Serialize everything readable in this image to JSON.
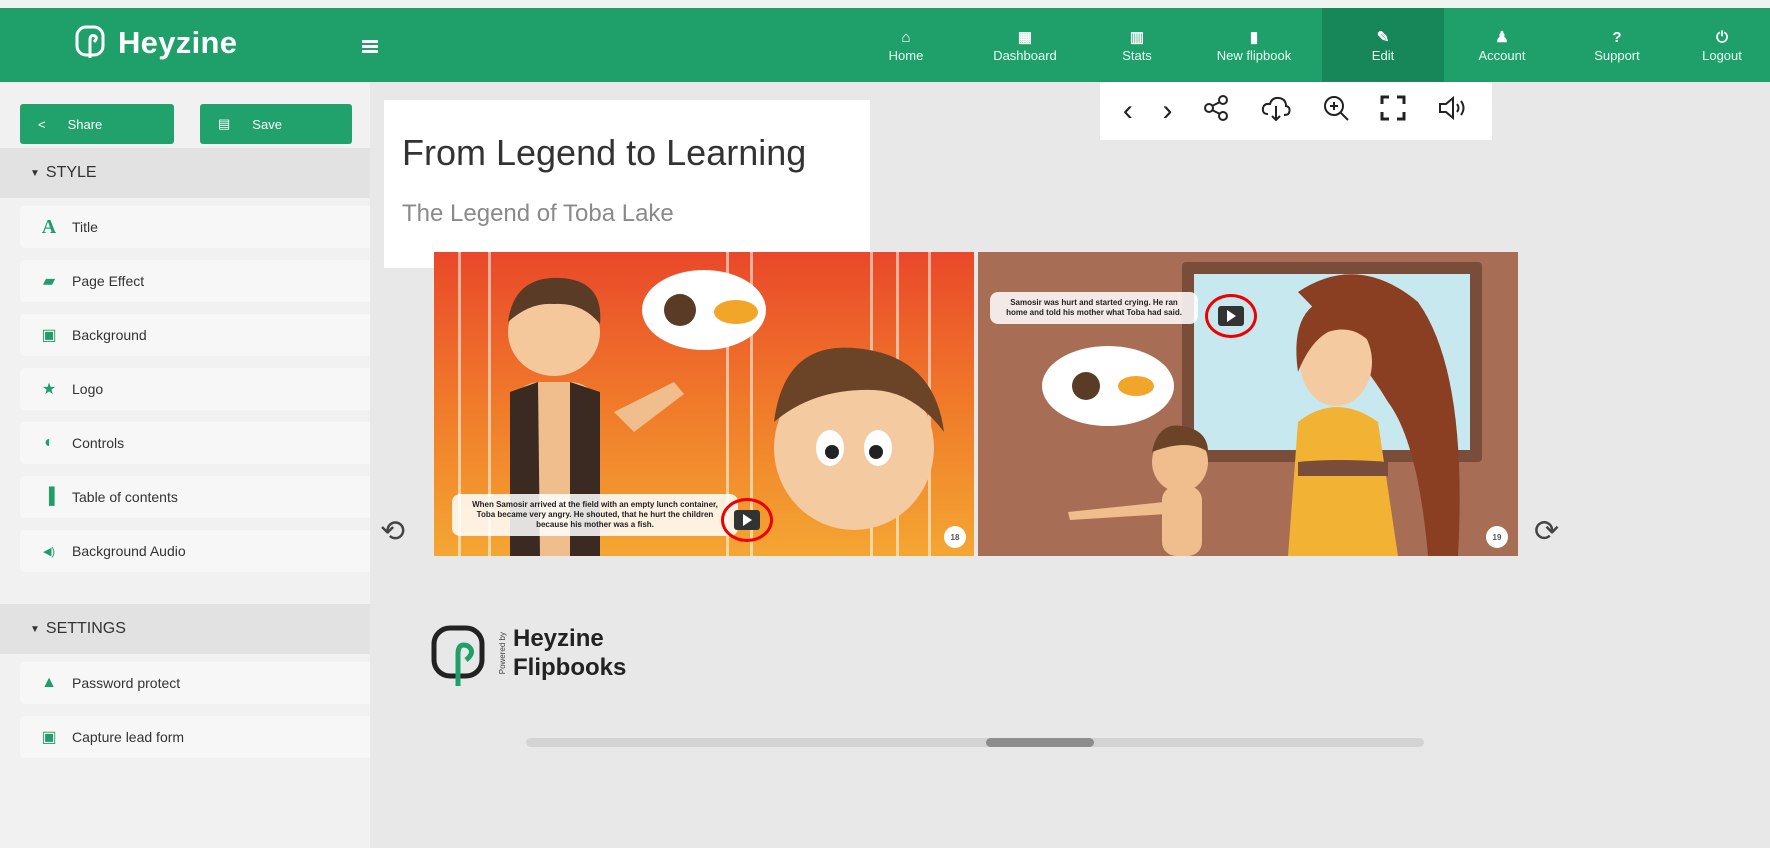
{
  "app": {
    "brand": "Heyzine"
  },
  "nav": [
    {
      "label": "Home",
      "icon": "home-icon",
      "glyph": "⌂"
    },
    {
      "label": "Dashboard",
      "icon": "dashboard-icon",
      "glyph": "▦"
    },
    {
      "label": "Stats",
      "icon": "stats-icon",
      "glyph": "▥"
    },
    {
      "label": "New flipbook",
      "icon": "new-file-icon",
      "glyph": "▮"
    },
    {
      "label": "Edit",
      "icon": "pencil-icon",
      "glyph": "✎"
    },
    {
      "label": "Account",
      "icon": "user-icon",
      "glyph": "♟"
    },
    {
      "label": "Support",
      "icon": "question-icon",
      "glyph": "?"
    },
    {
      "label": "Logout",
      "icon": "power-icon",
      "glyph": "⏻"
    }
  ],
  "sidebar": {
    "share_label": "Share",
    "save_label": "Save",
    "style_heading": "STYLE",
    "style_items": [
      {
        "label": "Title",
        "icon": "title-icon",
        "glyph": "A"
      },
      {
        "label": "Page Effect",
        "icon": "book-icon",
        "glyph": "▰"
      },
      {
        "label": "Background",
        "icon": "image-icon",
        "glyph": "▣"
      },
      {
        "label": "Logo",
        "icon": "star-icon",
        "glyph": "★"
      },
      {
        "label": "Controls",
        "icon": "toggle-icon",
        "glyph": "◐"
      },
      {
        "label": "Table of contents",
        "icon": "bookmark-icon",
        "glyph": "▐"
      },
      {
        "label": "Background Audio",
        "icon": "speaker-icon",
        "glyph": "◀)"
      }
    ],
    "settings_heading": "SETTINGS",
    "settings_items": [
      {
        "label": "Password protect",
        "icon": "lock-icon",
        "glyph": "▲"
      },
      {
        "label": "Capture lead form",
        "icon": "form-icon",
        "glyph": "▣"
      }
    ]
  },
  "main": {
    "title": "From Legend to Learning",
    "subtitle": "The Legend of Toba Lake",
    "left_page_caption": "When Samosir arrived at the field with an empty lunch container, Toba became very angry. He shouted, that he hurt the children because his mother was a fish.",
    "right_page_caption": "Samosir was hurt and started crying. He ran home and told his mother what Toba had said.",
    "left_page_number": "18",
    "right_page_number": "19",
    "powered_by": "Powered by",
    "footer_brand_line1": "Heyzine",
    "footer_brand_line2": "Flipbooks"
  },
  "colors": {
    "brand_green": "#1fa06a",
    "nav_active": "#17875a",
    "highlight_red": "#e00000"
  }
}
